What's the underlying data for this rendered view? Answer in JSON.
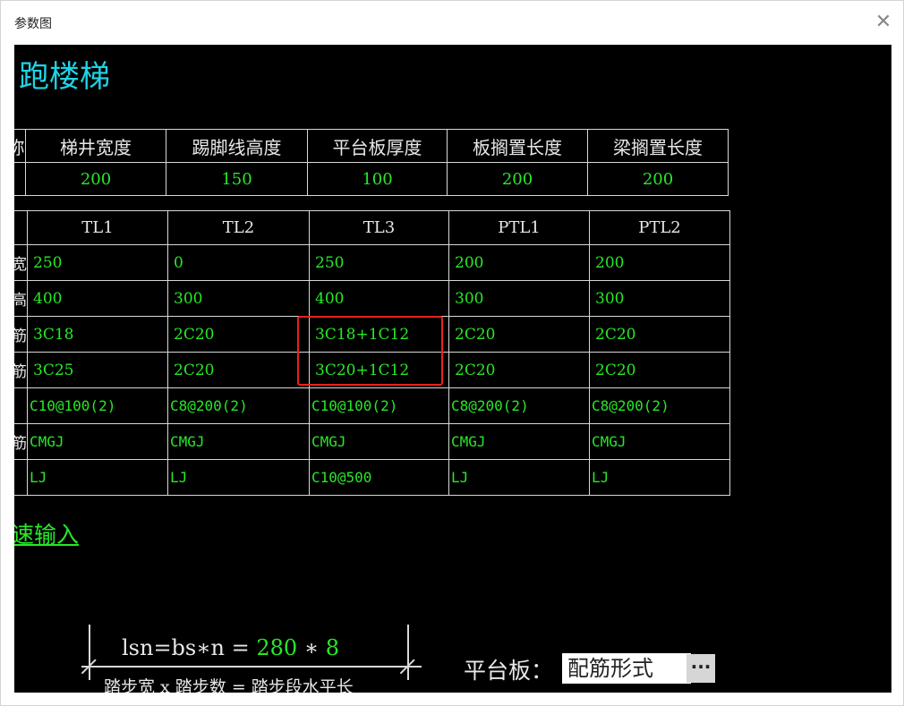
{
  "window": {
    "title": "参数图",
    "close_icon": "close-icon"
  },
  "heading": "跑楼梯",
  "table1": {
    "headers": [
      "称",
      "梯井宽度",
      "踢脚线高度",
      "平台板厚度",
      "板搁置长度",
      "梁搁置长度"
    ],
    "values": [
      "",
      "200",
      "150",
      "100",
      "200",
      "200"
    ]
  },
  "table2": {
    "headers": [
      "",
      "TL1",
      "TL2",
      "TL3",
      "PTL1",
      "PTL2"
    ],
    "rows": [
      [
        "宽",
        "250",
        "0",
        "250",
        "200",
        "200"
      ],
      [
        "高",
        "400",
        "300",
        "400",
        "300",
        "300"
      ],
      [
        "筋",
        "3C18",
        "2C20",
        "3C18+1C12",
        "2C20",
        "2C20"
      ],
      [
        "筋",
        "3C25",
        "2C20",
        "3C20+1C12",
        "2C20",
        "2C20"
      ],
      [
        "",
        "C10@100(2)",
        "C8@200(2)",
        "C10@100(2)",
        "C8@200(2)",
        "C8@200(2)"
      ],
      [
        "筋",
        "CMGJ",
        "CMGJ",
        "CMGJ",
        "CMGJ",
        "CMGJ"
      ],
      [
        "",
        "LJ",
        "LJ",
        "C10@500",
        "LJ",
        "LJ"
      ]
    ]
  },
  "quick_input_link": "速输入",
  "formula": {
    "lhs": "lsn=bs∗n = ",
    "bs_value": "280",
    "times": " ∗ ",
    "n_value": "8",
    "description": "踏步宽 x 踏步数 = 踏步段水平长"
  },
  "platform": {
    "label": "平台板：",
    "value": "配筋形式",
    "more_label": "···"
  },
  "colors": {
    "canvas_bg": "#000000",
    "value_green": "#27e827",
    "heading_cyan": "#1fd3e6",
    "highlight_red": "#e8231c"
  }
}
